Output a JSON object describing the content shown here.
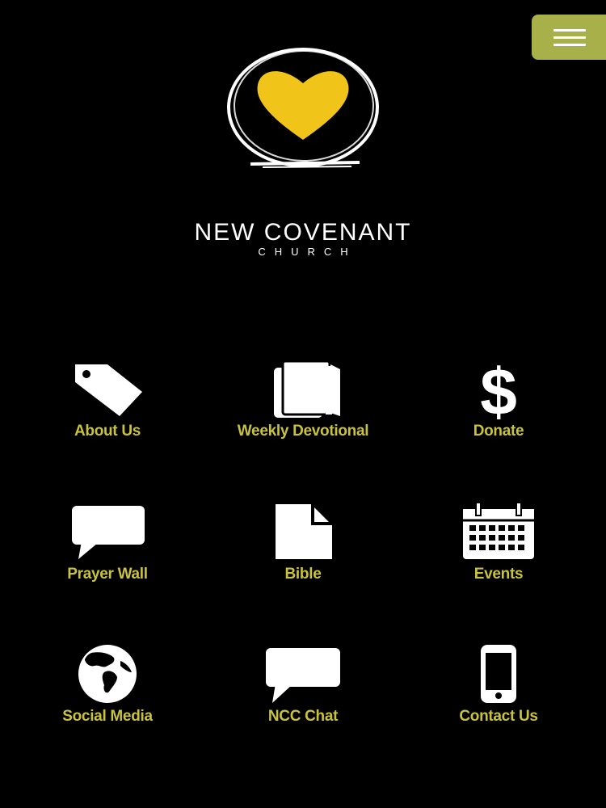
{
  "header": {
    "menu_icon": "hamburger-icon",
    "menu_color": "#a8b04a"
  },
  "logo": {
    "name": "NEW COVENANT",
    "sub": "CHURCH",
    "heart_color": "#f0c419"
  },
  "tiles": [
    {
      "label": "About Us",
      "icon": "tag-icon"
    },
    {
      "label": "Weekly Devotional",
      "icon": "book-icon"
    },
    {
      "label": "Donate",
      "icon": "dollar-icon"
    },
    {
      "label": "Prayer Wall",
      "icon": "speech-bubble-icon"
    },
    {
      "label": "Bible",
      "icon": "document-icon"
    },
    {
      "label": "Events",
      "icon": "calendar-icon"
    },
    {
      "label": "Social Media",
      "icon": "globe-icon"
    },
    {
      "label": "NCC Chat",
      "icon": "chat-icon"
    },
    {
      "label": "Contact Us",
      "icon": "phone-icon"
    }
  ],
  "label_color": "#c9c23b"
}
